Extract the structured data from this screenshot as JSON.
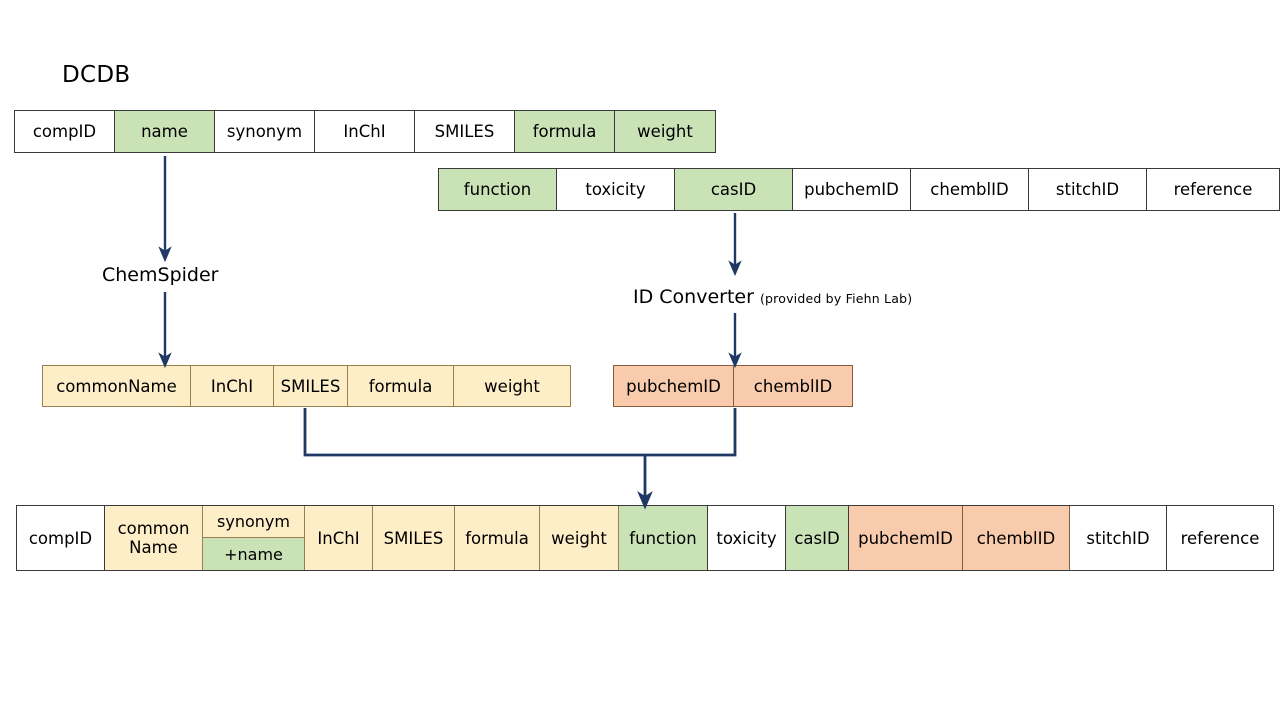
{
  "diagram": {
    "title": "DCDB",
    "process_nodes": [
      {
        "name": "ChemSpider",
        "label": "ChemSpider",
        "sublabel": ""
      },
      {
        "name": "ID Converter",
        "label": "ID Converter",
        "sublabel": "(provided by Fiehn Lab)"
      }
    ],
    "colors": {
      "green": "#c9e2b6",
      "cream": "#fdeec8",
      "orange": "#f8cbad",
      "white": "#ffffff",
      "border_dark": "#3a3a3a",
      "border_cream": "#9c7f4e",
      "border_orange": "#8a5a3c",
      "arrow": "#1f3864"
    },
    "tables": {
      "dcdb_row1": {
        "name": "DCDB fields row 1",
        "cells": [
          {
            "label": "compID",
            "fill": "white"
          },
          {
            "label": "name",
            "fill": "green"
          },
          {
            "label": "synonym",
            "fill": "white"
          },
          {
            "label": "InChI",
            "fill": "white"
          },
          {
            "label": "SMILES",
            "fill": "white"
          },
          {
            "label": "formula",
            "fill": "green"
          },
          {
            "label": "weight",
            "fill": "green"
          }
        ]
      },
      "dcdb_row2": {
        "name": "DCDB fields row 2",
        "cells": [
          {
            "label": "function",
            "fill": "green"
          },
          {
            "label": "toxicity",
            "fill": "white"
          },
          {
            "label": "casID",
            "fill": "green"
          },
          {
            "label": "pubchemID",
            "fill": "white"
          },
          {
            "label": "chemblID",
            "fill": "white"
          },
          {
            "label": "stitchID",
            "fill": "white"
          },
          {
            "label": "reference",
            "fill": "white"
          }
        ]
      },
      "chemspider_out": {
        "name": "ChemSpider output fields",
        "cells": [
          {
            "label": "commonName",
            "fill": "cream"
          },
          {
            "label": "InChI",
            "fill": "cream"
          },
          {
            "label": "SMILES",
            "fill": "cream"
          },
          {
            "label": "formula",
            "fill": "cream"
          },
          {
            "label": "weight",
            "fill": "cream"
          }
        ]
      },
      "idconverter_out": {
        "name": "ID Converter output fields",
        "cells": [
          {
            "label": "pubchemID",
            "fill": "orange"
          },
          {
            "label": "chemblID",
            "fill": "orange"
          }
        ]
      },
      "merged": {
        "name": "Merged final table",
        "cells": [
          {
            "label": "compID",
            "fill": "white"
          },
          {
            "label": "common\nName",
            "fill": "cream",
            "lines": [
              "common",
              "Name"
            ]
          },
          {
            "label": "synonym / +name",
            "fill": "split",
            "top": "synonym",
            "bottom": "+name"
          },
          {
            "label": "InChI",
            "fill": "cream"
          },
          {
            "label": "SMILES",
            "fill": "cream"
          },
          {
            "label": "formula",
            "fill": "cream"
          },
          {
            "label": "weight",
            "fill": "cream"
          },
          {
            "label": "function",
            "fill": "green"
          },
          {
            "label": "toxicity",
            "fill": "white"
          },
          {
            "label": "casID",
            "fill": "green"
          },
          {
            "label": "pubchemID",
            "fill": "orange"
          },
          {
            "label": "chemblID",
            "fill": "orange"
          },
          {
            "label": "stitchID",
            "fill": "white"
          },
          {
            "label": "reference",
            "fill": "white"
          }
        ]
      }
    },
    "arrows": [
      {
        "name": "name-to-chemspider",
        "from": "name",
        "to": "ChemSpider"
      },
      {
        "name": "chemspider-to-output",
        "from": "ChemSpider",
        "to": "commonName row"
      },
      {
        "name": "casid-to-idconverter",
        "from": "casID",
        "to": "ID Converter"
      },
      {
        "name": "idconverter-to-output",
        "from": "ID Converter",
        "to": "pubchemID row"
      },
      {
        "name": "merge-connector-to-final",
        "from": "outputs",
        "to": "merged table"
      }
    ]
  }
}
